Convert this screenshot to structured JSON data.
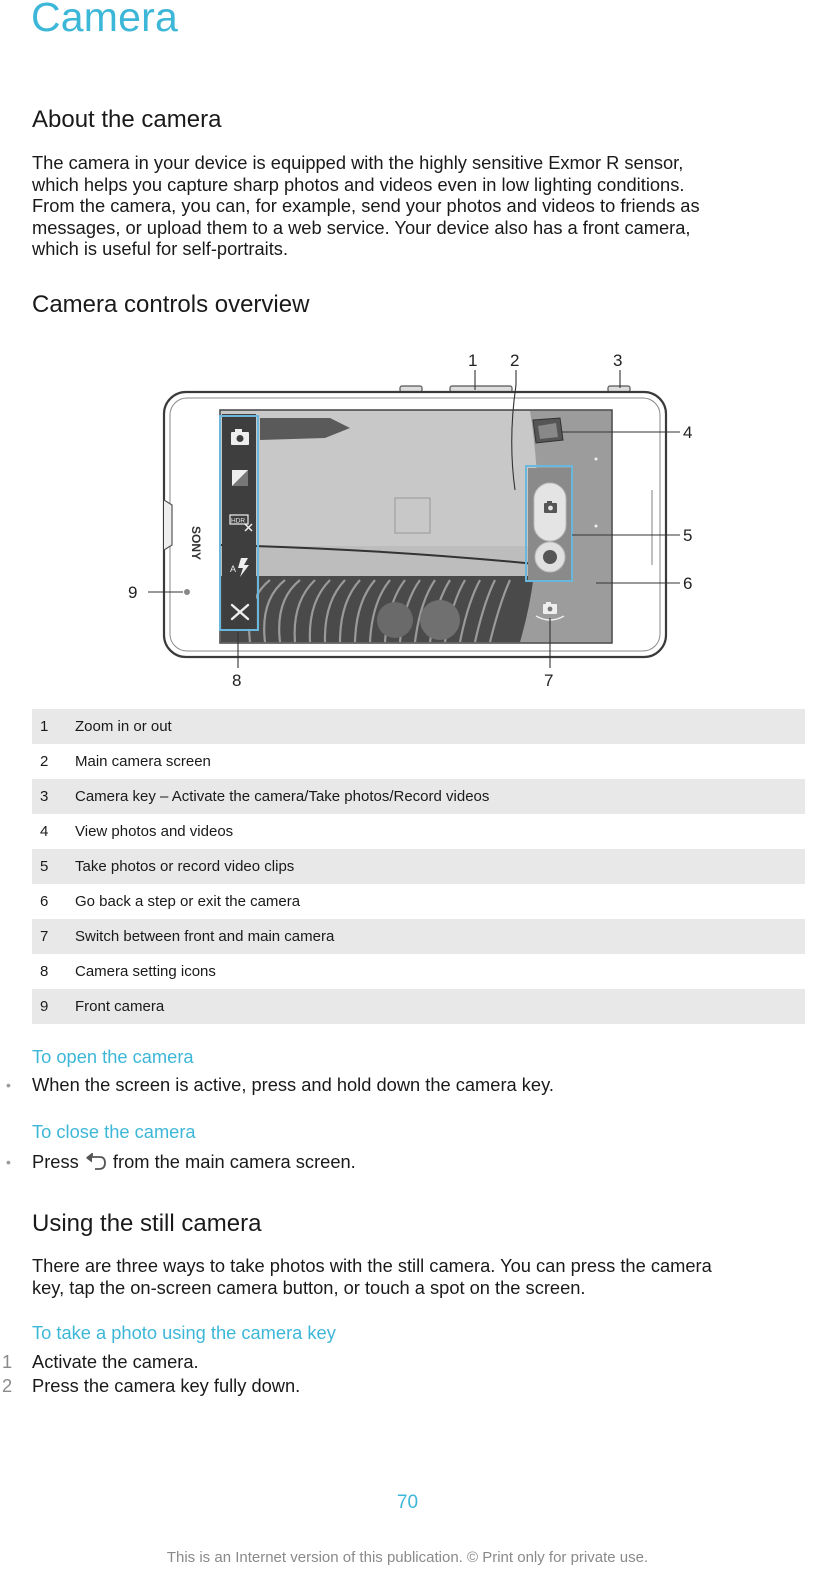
{
  "chapter_title": "Camera",
  "sections": {
    "about": {
      "heading": "About the camera",
      "paragraph_lines": [
        "The camera in your device is equipped with the highly sensitive Exmor R sensor,",
        "which helps you capture sharp photos and videos even in low lighting conditions.",
        "From the camera, you can, for example, send your photos and videos to friends as",
        "messages, or upload them to a web service. Your device also has a front camera,",
        "which is useful for self-portraits."
      ]
    },
    "overview": {
      "heading": "Camera controls overview",
      "figure": {
        "brand_label": "SONY",
        "callouts": [
          "1",
          "2",
          "3",
          "4",
          "5",
          "6",
          "7",
          "8",
          "9"
        ],
        "icons": [
          "camera-mode-icon",
          "exposure-icon",
          "hdr-off-icon",
          "auto-flash-icon",
          "settings-tools-icon",
          "shutter-camera-icon",
          "record-video-icon",
          "switch-camera-icon",
          "gallery-thumbnail"
        ]
      },
      "legend": [
        {
          "num": "1",
          "desc": "Zoom in or out"
        },
        {
          "num": "2",
          "desc": "Main camera screen"
        },
        {
          "num": "3",
          "desc": "Camera key – Activate the camera/Take photos/Record videos"
        },
        {
          "num": "4",
          "desc": "View photos and videos"
        },
        {
          "num": "5",
          "desc": "Take photos or record video clips"
        },
        {
          "num": "6",
          "desc": "Go back a step or exit the camera"
        },
        {
          "num": "7",
          "desc": "Switch between front and main camera"
        },
        {
          "num": "8",
          "desc": "Camera setting icons"
        },
        {
          "num": "9",
          "desc": "Front camera"
        }
      ]
    },
    "open_task": {
      "title": "To open the camera",
      "bullet": "•",
      "item": "When the screen is active, press and hold down the camera key."
    },
    "close_task": {
      "title": "To close the camera",
      "bullet": "•",
      "item_before": "Press",
      "item_icon": "back-icon",
      "item_after": "from the main camera screen."
    },
    "still": {
      "heading": "Using the still camera",
      "paragraph_lines": [
        "There are three ways to take photos with the still camera. You can press the camera",
        "key, tap the on-screen camera button, or touch a spot on the screen."
      ]
    },
    "photo_task": {
      "title": "To take a photo using the camera key",
      "steps": [
        {
          "num": "1",
          "text": "Activate the camera."
        },
        {
          "num": "2",
          "text": "Press the camera key fully down."
        }
      ]
    }
  },
  "footer": {
    "page_number": "70",
    "note": "This is an Internet version of this publication. © Print only for private use."
  },
  "colors": {
    "accent": "#3db7d8",
    "text": "#1a1a1a",
    "table_shade": "#e8e8e8",
    "muted": "#8a8a8a"
  }
}
